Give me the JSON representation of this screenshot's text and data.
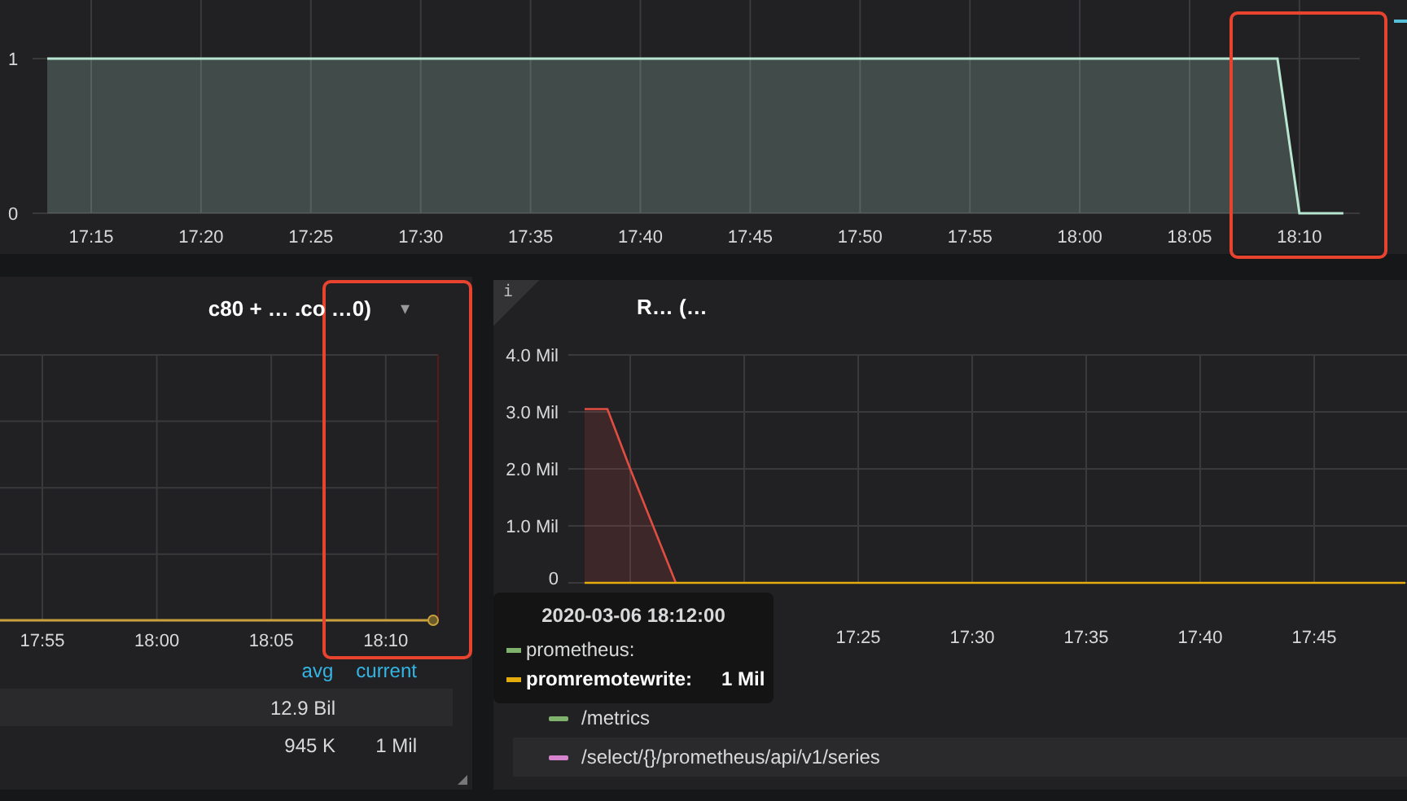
{
  "top_panel": {
    "chart_data": {
      "type": "area",
      "grid": true,
      "categories": [
        null,
        null,
        "17:15",
        null,
        null,
        null,
        null,
        "17:20",
        null,
        null,
        null,
        null,
        "17:25",
        null,
        null,
        null,
        null,
        "17:30",
        null,
        null,
        null,
        null,
        "17:35",
        null,
        null,
        null,
        null,
        "17:40",
        null,
        null,
        null,
        null,
        "17:45",
        null,
        null,
        null,
        null,
        "17:50",
        null,
        null,
        null,
        null,
        "17:55",
        null,
        null,
        null,
        null,
        "18:00",
        null,
        null,
        null,
        null,
        "18:05",
        null,
        null,
        null,
        null,
        "18:10",
        null,
        null
      ],
      "ylim": [
        0,
        1
      ],
      "series": [
        {
          "color": "#b8e6d0",
          "values": [
            1,
            1,
            1,
            1,
            1,
            1,
            1,
            1,
            1,
            1,
            1,
            1,
            1,
            1,
            1,
            1,
            1,
            1,
            1,
            1,
            1,
            1,
            1,
            1,
            1,
            1,
            1,
            1,
            1,
            1,
            1,
            1,
            1,
            1,
            1,
            1,
            1,
            1,
            1,
            1,
            1,
            1,
            1,
            1,
            1,
            1,
            1,
            1,
            1,
            1,
            1,
            1,
            1,
            1,
            1,
            1,
            1,
            0,
            0,
            0
          ]
        }
      ],
      "yticks": [
        0,
        1
      ]
    }
  },
  "left_panel": {
    "title": "c80 + … .co …0)",
    "menu_caret": "▾",
    "x_labels": [
      "17:55",
      "18:00",
      "18:05",
      "18:10"
    ],
    "legend": {
      "columns": [
        "avg",
        "current"
      ],
      "rows": [
        {
          "avg": "12.9 Bil",
          "current": ""
        },
        {
          "avg": "945 K",
          "current": "1 Mil"
        }
      ]
    }
  },
  "right_panel": {
    "info_mark": "i",
    "title": "R… (…",
    "chart_data": {
      "type": "area",
      "grid": true,
      "categories": [
        null,
        null,
        null,
        null,
        null,
        null,
        null,
        null,
        null,
        null,
        null,
        null,
        "17:25",
        null,
        null,
        null,
        null,
        "17:30",
        null,
        null,
        null,
        null,
        "17:35",
        null,
        null,
        null,
        null,
        "17:40",
        null,
        null,
        null,
        null,
        "17:45",
        null,
        null,
        null,
        null
      ],
      "ylim": [
        0,
        4
      ],
      "series": [
        {
          "color": "#e24d42",
          "values": [
            3.05,
            3.05,
            2.0,
            1.0,
            0,
            null,
            null,
            null,
            null,
            null,
            null,
            null,
            null,
            null,
            null,
            null,
            null,
            null,
            null,
            null,
            null,
            null,
            null,
            null,
            null,
            null,
            null,
            null,
            null,
            null,
            null,
            null,
            null,
            null,
            null,
            null,
            null
          ]
        },
        {
          "color": "#e5ac0e",
          "type": "line",
          "values": [
            0,
            0,
            0,
            0,
            0,
            0,
            0,
            0,
            0,
            0,
            0,
            0,
            0,
            0,
            0,
            0,
            0,
            0,
            0,
            0,
            0,
            0,
            0,
            0,
            0,
            0,
            0,
            0,
            0,
            0,
            0,
            0,
            0,
            0,
            0,
            0,
            0
          ]
        }
      ],
      "yticks": [
        {
          "value": 0,
          "label": "0"
        },
        {
          "value": 1,
          "label": "1.0 Mil"
        },
        {
          "value": 2,
          "label": "2.0 Mil"
        },
        {
          "value": 3,
          "label": "3.0 Mil"
        },
        {
          "value": 4,
          "label": "4.0 Mil"
        }
      ]
    },
    "legend": [
      {
        "name": "/metrics",
        "color": "#7eb26d"
      },
      {
        "name": "/select/{}/prometheus/api/v1/series",
        "color": "#d683ce"
      }
    ]
  },
  "tooltip": {
    "time": "2020-03-06 18:12:00",
    "rows": [
      {
        "name": "prometheus:",
        "value": "",
        "color": "#7eb26d",
        "selected": false
      },
      {
        "name": "promremotewrite:",
        "value": "1 Mil",
        "color": "#e5ac0e",
        "selected": true
      }
    ]
  }
}
